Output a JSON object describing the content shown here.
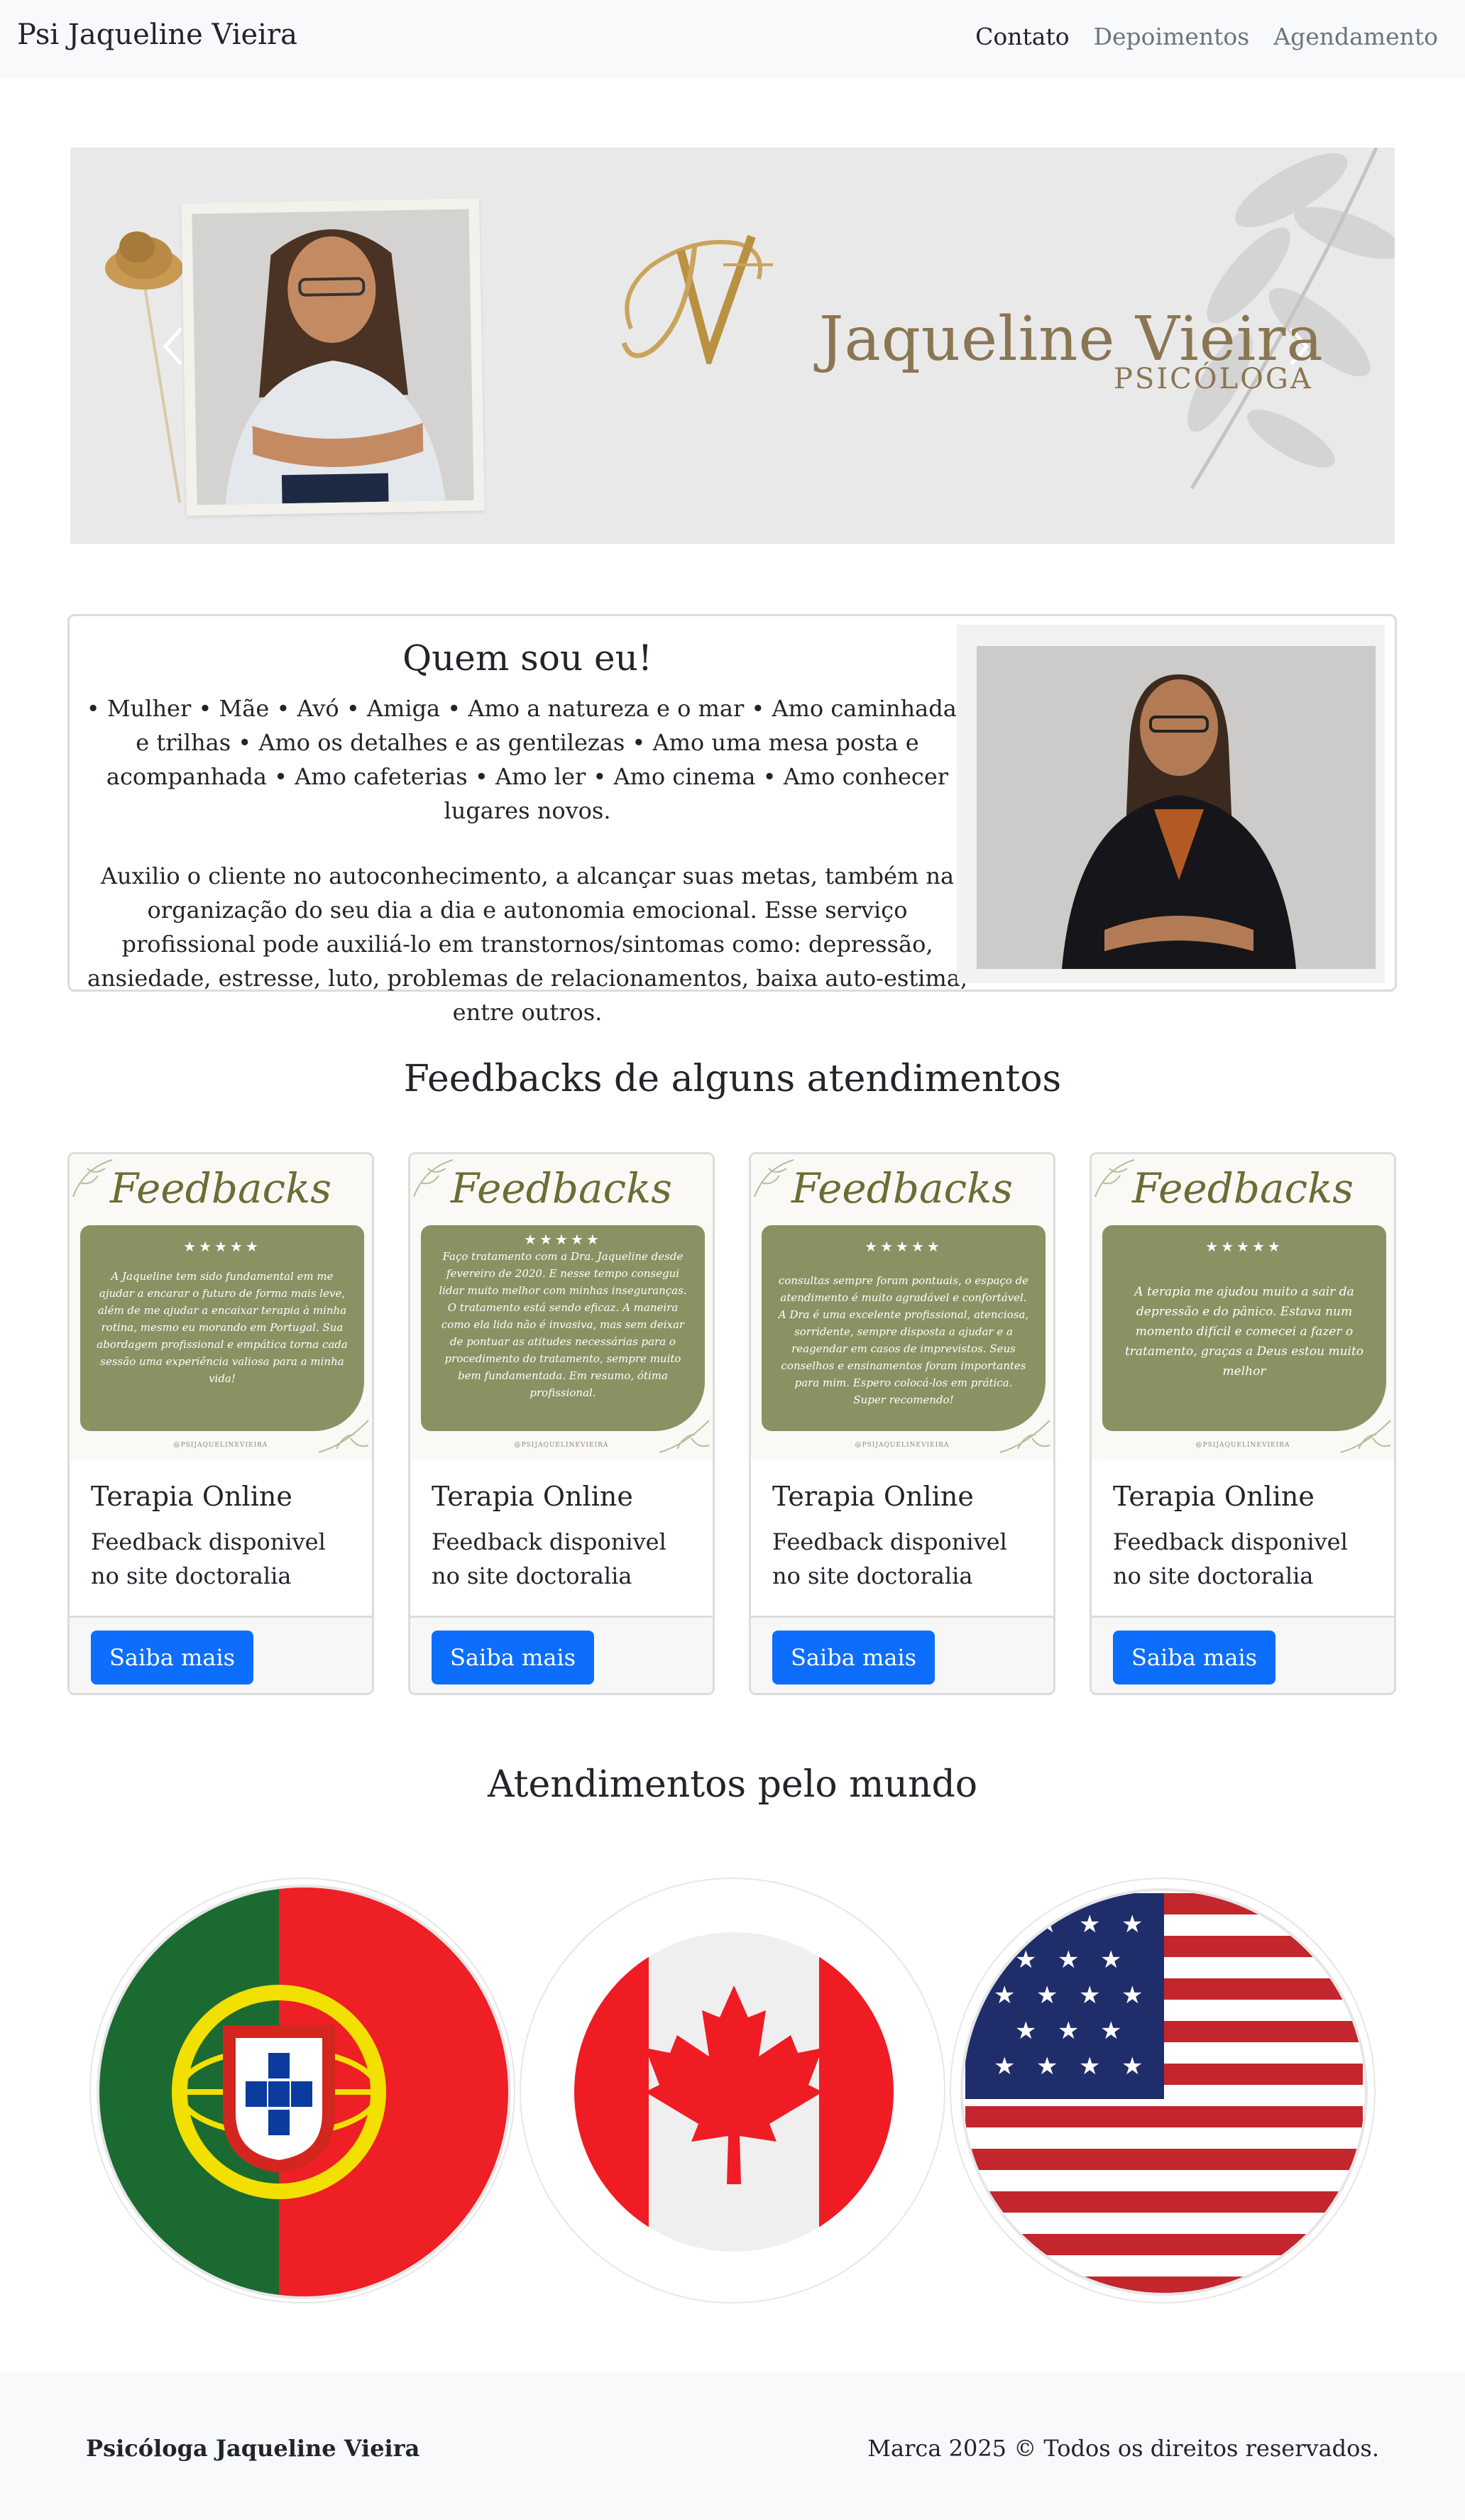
{
  "navbar": {
    "brand": "Psi Jaqueline Vieira",
    "links": [
      {
        "label": "Contato",
        "active": true
      },
      {
        "label": "Depoimentos",
        "active": false
      },
      {
        "label": "Agendamento",
        "active": false
      }
    ]
  },
  "hero": {
    "logo_name": "Jaqueline Vieira",
    "logo_sub": "PSICÓLOGA",
    "accent_color": "#b99a5b"
  },
  "about": {
    "title": "Quem sou eu!",
    "paragraph1": "• Mulher • Mãe • Avó • Amiga • Amo a natureza e o mar • Amo caminhadas e trilhas • Amo os detalhes e as gentilezas • Amo uma mesa posta e acompanhada • Amo cafeterias • Amo ler • Amo cinema • Amo conhecer lugares novos.",
    "paragraph2": "Auxilio o cliente no autoconhecimento, a alcançar suas metas, também na organização do seu dia a dia e autonomia emocional. Esse serviço profissional pode auxiliá-lo em transtornos/sintomas como: depressão, ansiedade, estresse, luto, problemas de relacionamentos, baixa auto-estima, entre outros."
  },
  "feedbacks": {
    "title": "Feedbacks de alguns atendimentos",
    "cards": [
      {
        "image_title": "Feedbacks",
        "stars": "★★★★★",
        "image_text": "A Jaqueline tem sido fundamental em me ajudar a encarar o futuro de forma mais leve, além de me ajudar a encaixar terapia à minha rotina, mesmo eu morando em Portugal. Sua abordagem profissional e empática torna cada sessão uma experiência valiosa para a minha vida!",
        "handle": "@PSIJAQUELINEVIEIRA",
        "title": "Terapia Online",
        "text": "Feedback disponivel no site doctoralia",
        "button": "Saiba mais"
      },
      {
        "image_title": "Feedbacks",
        "stars": "★★★★★",
        "image_text": "Faço tratamento com a Dra. Jaqueline desde fevereiro de 2020. E nesse tempo consegui lidar muito melhor com minhas inseguranças. O tratamento está sendo eficaz. A maneira como ela lida não é invasiva, mas sem deixar de pontuar as atitudes necessárias para o procedimento do tratamento, sempre muito bem fundamentada. Em resumo, ótima profissional.",
        "handle": "@PSIJAQUELINEVIEIRA",
        "title": "Terapia Online",
        "text": "Feedback disponivel no site doctoralia",
        "button": "Saiba mais"
      },
      {
        "image_title": "Feedbacks",
        "stars": "★★★★★",
        "image_text": "consultas sempre foram pontuais, o espaço de atendimento é muito agradável e confortável. A Dra é uma excelente profissional, atenciosa, sorridente, sempre disposta a ajudar e a reagendar em casos de imprevistos. Seus conselhos e ensinamentos foram importantes para mim. Espero colocá-los em prática. Super recomendo!",
        "handle": "@PSIJAQUELINEVIEIRA",
        "title": "Terapia Online",
        "text": "Feedback disponivel no site doctoralia",
        "button": "Saiba mais"
      },
      {
        "image_title": "Feedbacks",
        "stars": "★★★★★",
        "image_text": "A terapia me ajudou muito a sair da depressão e do pânico. Estava num momento difícil e comecei a fazer o tratamento, graças a Deus estou muito melhor",
        "handle": "@PSIJAQUELINEVIEIRA",
        "title": "Terapia Online",
        "text": "Feedback disponivel no site doctoralia",
        "button": "Saiba mais"
      }
    ]
  },
  "world": {
    "title": "Atendimentos pelo mundo",
    "flags": [
      "portugal-flag",
      "canada-flag",
      "usa-flag"
    ]
  },
  "footer": {
    "left": "Psicóloga Jaqueline Vieira",
    "right": "Marca 2025 © Todos os direitos reservados."
  }
}
